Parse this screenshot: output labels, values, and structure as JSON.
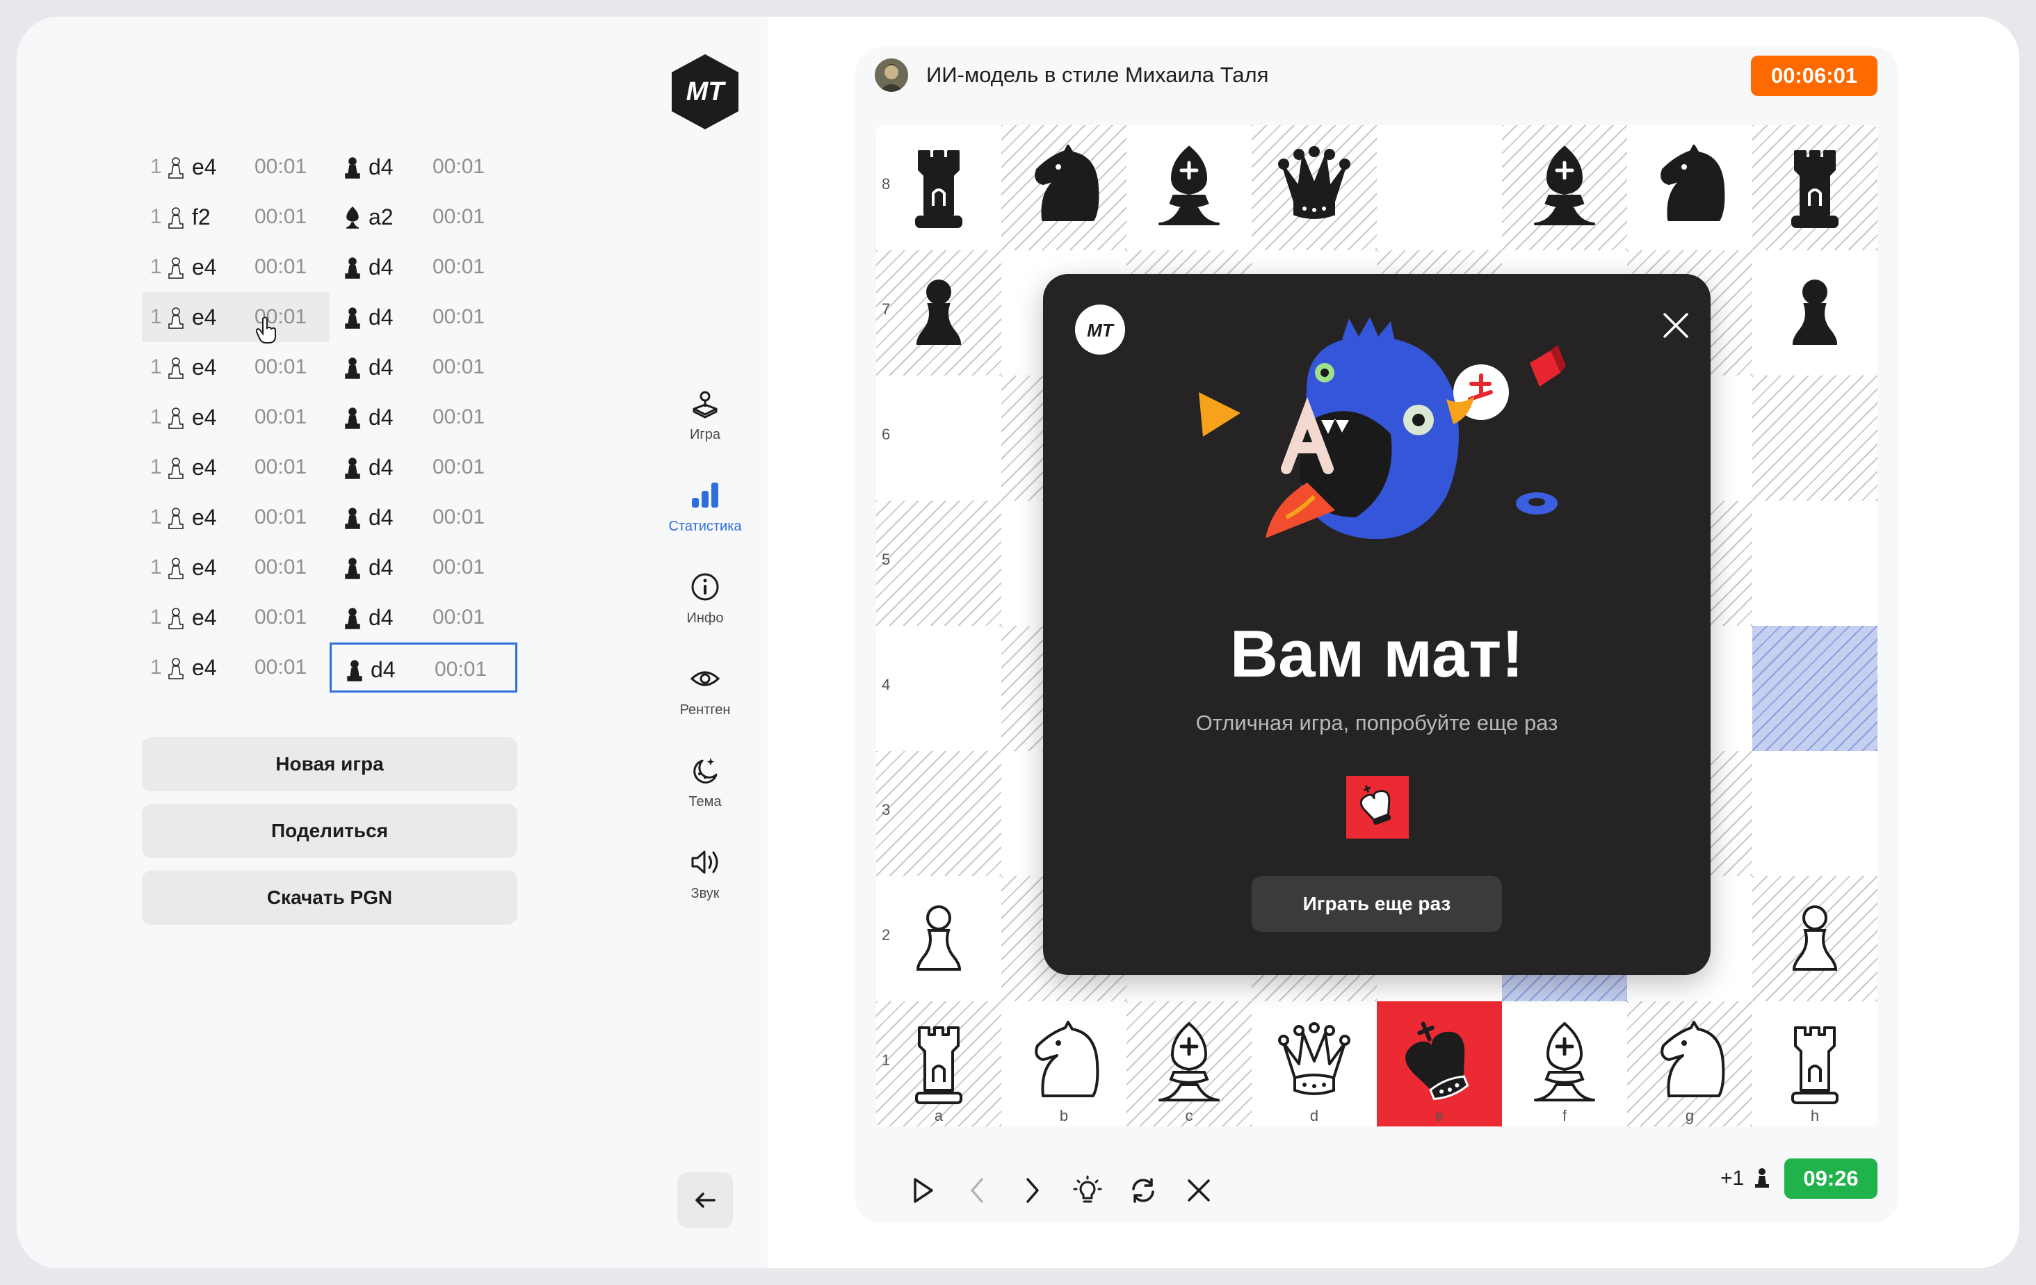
{
  "logo": {
    "text": "MT"
  },
  "moves": [
    {
      "num": "1",
      "white": "e4",
      "white_time": "00:01",
      "black": "d4",
      "black_time": "00:01"
    },
    {
      "num": "1",
      "white": "f2",
      "white_time": "00:01",
      "black": "a2",
      "black_time": "00:01"
    },
    {
      "num": "1",
      "white": "e4",
      "white_time": "00:01",
      "black": "d4",
      "black_time": "00:01"
    },
    {
      "num": "1",
      "white": "e4",
      "white_time": "00:01",
      "black": "d4",
      "black_time": "00:01"
    },
    {
      "num": "1",
      "white": "e4",
      "white_time": "00:01",
      "black": "d4",
      "black_time": "00:01"
    },
    {
      "num": "1",
      "white": "e4",
      "white_time": "00:01",
      "black": "d4",
      "black_time": "00:01"
    },
    {
      "num": "1",
      "white": "e4",
      "white_time": "00:01",
      "black": "d4",
      "black_time": "00:01"
    },
    {
      "num": "1",
      "white": "e4",
      "white_time": "00:01",
      "black": "d4",
      "black_time": "00:01"
    },
    {
      "num": "1",
      "white": "e4",
      "white_time": "00:01",
      "black": "d4",
      "black_time": "00:01"
    },
    {
      "num": "1",
      "white": "e4",
      "white_time": "00:01",
      "black": "d4",
      "black_time": "00:01"
    },
    {
      "num": "1",
      "white": "e4",
      "white_time": "00:01",
      "black": "d4",
      "black_time": "00:01"
    }
  ],
  "actions": {
    "new_game": "Новая игра",
    "share": "Поделиться",
    "download_pgn": "Скачать PGN"
  },
  "nav": {
    "game": "Игра",
    "stats": "Статистика",
    "info": "Инфо",
    "xray": "Рентген",
    "theme": "Тема",
    "sound": "Звук"
  },
  "opponent": {
    "name": "ИИ-модель в стиле Михаила Таля",
    "timer": "00:06:01"
  },
  "player": {
    "timer": "09:26",
    "advantage": "+1"
  },
  "board": {
    "ranks": [
      "8",
      "7",
      "6",
      "5",
      "4",
      "3",
      "2",
      "1"
    ],
    "files": [
      "a",
      "b",
      "c",
      "d",
      "e",
      "f",
      "g",
      "h"
    ],
    "rows": [
      [
        "br",
        "bn",
        "bb",
        "bq",
        "",
        "bb",
        "bn",
        "br"
      ],
      [
        "bp",
        "",
        "",
        "",
        "",
        "",
        "",
        "bp"
      ],
      [
        "",
        "",
        "",
        "",
        "",
        "",
        "",
        ""
      ],
      [
        "",
        "",
        "",
        "",
        "",
        "",
        "",
        ""
      ],
      [
        "",
        "",
        "",
        "",
        "",
        "",
        "",
        ""
      ],
      [
        "",
        "",
        "",
        "",
        "",
        "",
        "",
        ""
      ],
      [
        "wp",
        "",
        "",
        "",
        "",
        "",
        "",
        "wp"
      ],
      [
        "wr",
        "wn",
        "wb",
        "wq",
        "bk",
        "wb",
        "wn",
        "wr"
      ]
    ],
    "highlight_squares": [
      "h4",
      "f2"
    ],
    "check_square": "e1"
  },
  "modal": {
    "title": "Вам мат!",
    "subtitle": "Отличная игра, попробуйте еще раз",
    "play_again": "Играть еще раз"
  },
  "colors": {
    "accent_blue": "#2f6fdc",
    "timer_orange": "#ff6a00",
    "timer_green": "#20b24b",
    "check_red": "#ec2a33",
    "modal_bg": "#252323"
  }
}
